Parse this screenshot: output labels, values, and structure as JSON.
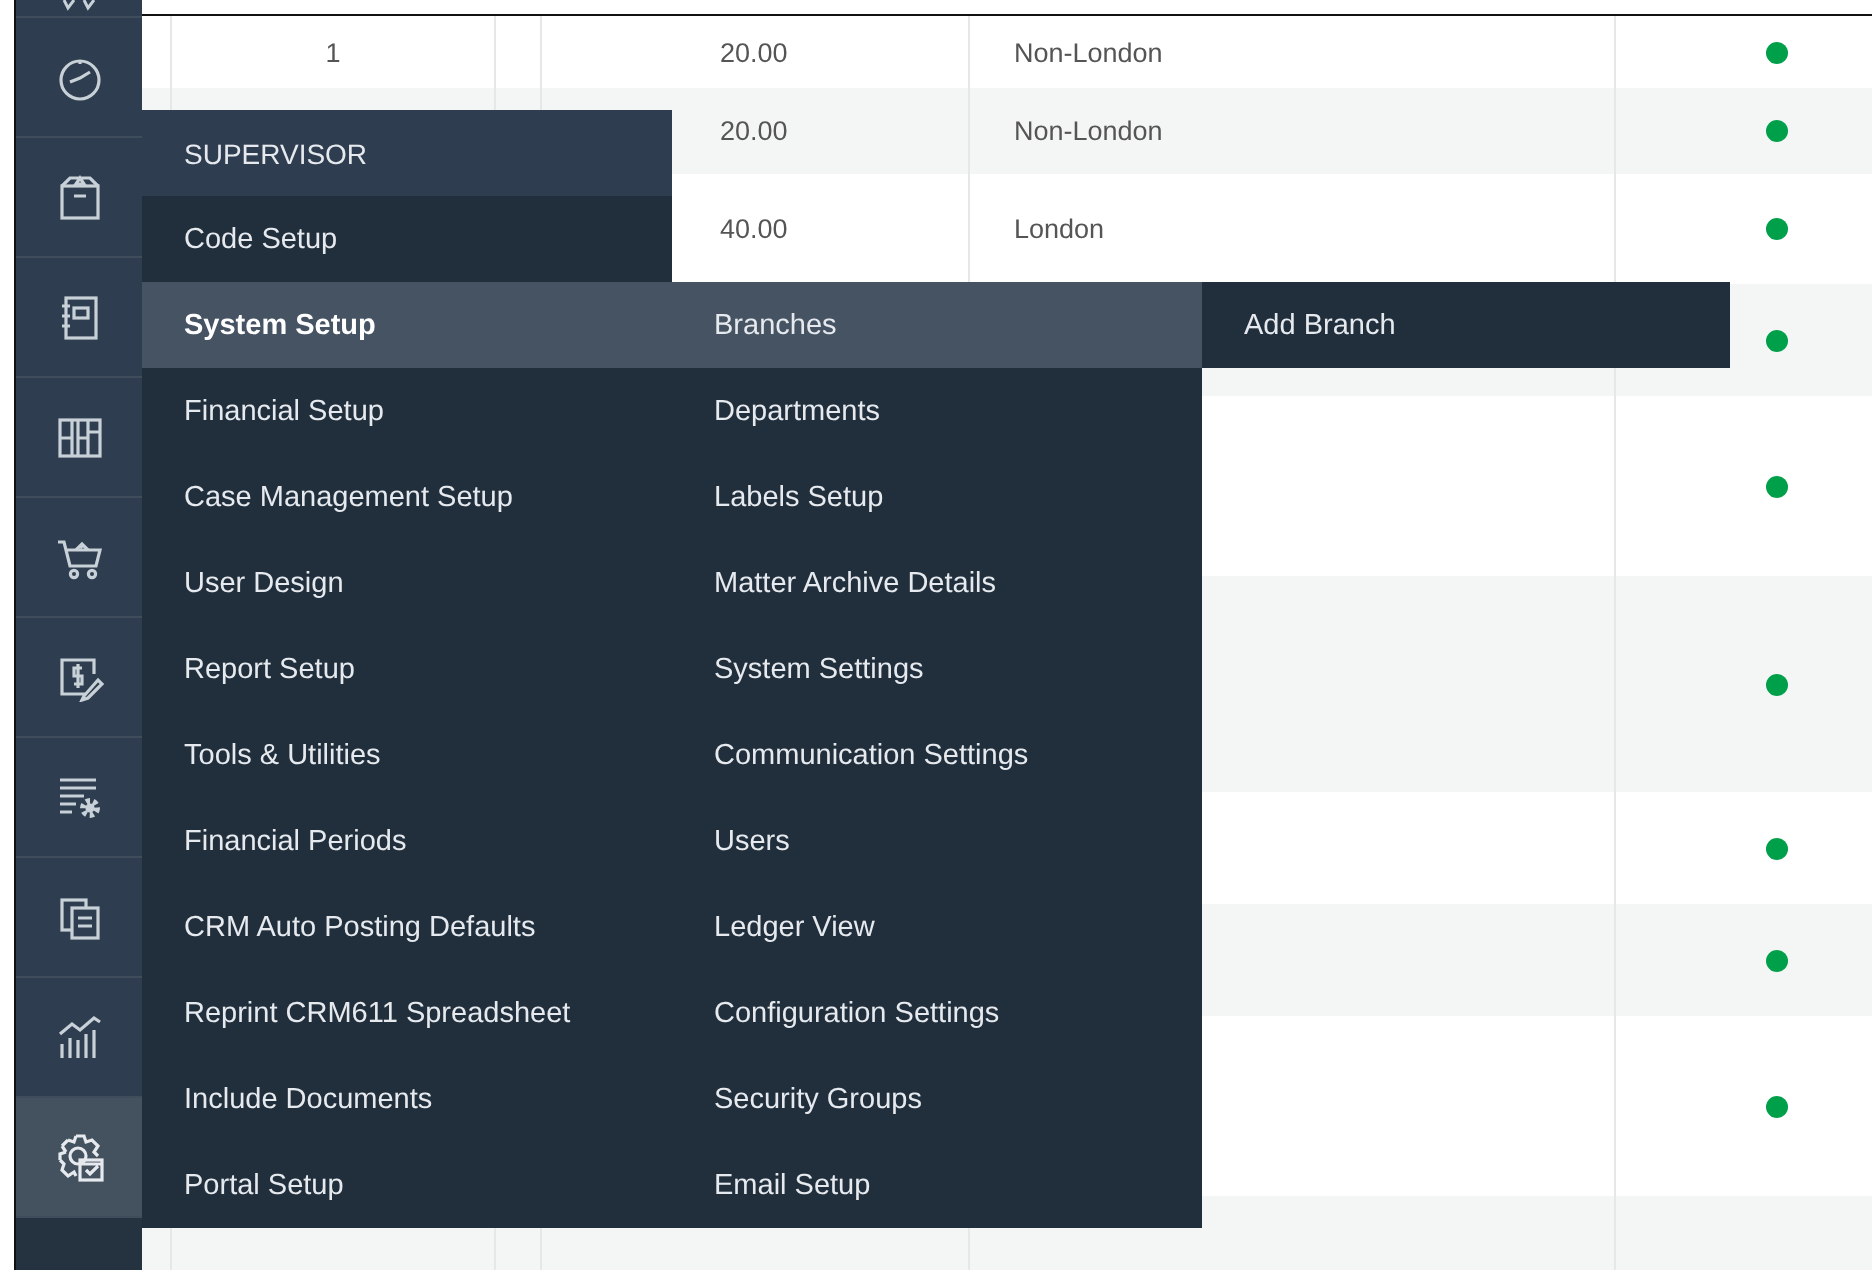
{
  "sidebar": {
    "items": [
      {
        "kind": "stars",
        "selected": false
      },
      {
        "kind": "clock",
        "selected": false
      },
      {
        "kind": "box",
        "selected": false
      },
      {
        "kind": "notebook",
        "selected": false
      },
      {
        "kind": "columns",
        "selected": false
      },
      {
        "kind": "cart",
        "selected": false
      },
      {
        "kind": "dollar",
        "selected": false
      },
      {
        "kind": "listgear",
        "selected": false
      },
      {
        "kind": "documents",
        "selected": false
      },
      {
        "kind": "chart",
        "selected": false
      },
      {
        "kind": "gear",
        "selected": true
      }
    ]
  },
  "table": {
    "rows": [
      {
        "column_1": "1",
        "column_3": "20.00",
        "column_4": "Non-London",
        "color": "#00a04a"
      },
      {
        "column_3": "20.00",
        "column_4": "Non-London",
        "color": "#00a04a"
      },
      {
        "column_3": "40.00",
        "column_4": "London",
        "color": "#00a04a"
      },
      {
        "color": "#00a04a"
      },
      {
        "color": "#00a04a"
      },
      {
        "color": "#00a04a"
      },
      {
        "color": "#00a04a"
      },
      {
        "color": "#00a04a"
      },
      {
        "color": "#00a04a"
      }
    ]
  },
  "menu": {
    "title": "SUPERVISOR",
    "items": [
      {
        "label": "Code Setup",
        "selected": false
      },
      {
        "label": "System Setup",
        "selected": true,
        "children": [
          {
            "label": "Branches",
            "selected": true,
            "children": [
              {
                "label": "Add Branch",
                "selected": false
              }
            ]
          },
          {
            "label": "Departments",
            "selected": false
          },
          {
            "label": "Labels Setup",
            "selected": false
          },
          {
            "label": "Matter Archive Details",
            "selected": false
          },
          {
            "label": "System Settings",
            "selected": false
          },
          {
            "label": "Communication Settings",
            "selected": false
          },
          {
            "label": "Users",
            "selected": false
          },
          {
            "label": "Ledger View",
            "selected": false
          },
          {
            "label": "Configuration Settings",
            "selected": false
          },
          {
            "label": "Security Groups",
            "selected": false
          },
          {
            "label": "Email Setup",
            "selected": false
          }
        ]
      },
      {
        "label": "Financial Setup",
        "selected": false
      },
      {
        "label": "Case Management Setup",
        "selected": false
      },
      {
        "label": "User Design",
        "selected": false
      },
      {
        "label": "Report Setup",
        "selected": false
      },
      {
        "label": "Tools & Utilities",
        "selected": false
      },
      {
        "label": "Financial Periods",
        "selected": false
      },
      {
        "label": "CRM Auto Posting Defaults",
        "selected": false
      },
      {
        "label": "Reprint CRM611 Spreadsheet",
        "selected": false
      },
      {
        "label": "Include Documents",
        "selected": false
      },
      {
        "label": "Portal Setup",
        "selected": false
      }
    ]
  }
}
